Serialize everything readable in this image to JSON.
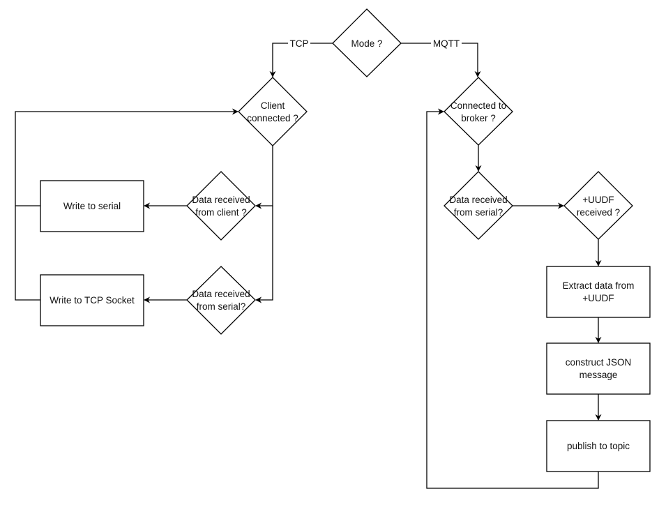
{
  "diagram": {
    "type": "flowchart",
    "nodes": {
      "mode": {
        "shape": "decision",
        "lines": [
          "Mode ?"
        ]
      },
      "client_connected": {
        "shape": "decision",
        "lines": [
          "Client",
          "connected ?"
        ]
      },
      "data_from_client": {
        "shape": "decision",
        "lines": [
          "Data received",
          "from client ?"
        ]
      },
      "write_serial": {
        "shape": "process",
        "lines": [
          "Write to serial"
        ]
      },
      "data_from_serial_tcp": {
        "shape": "decision",
        "lines": [
          "Data received",
          "from serial?"
        ]
      },
      "write_tcp": {
        "shape": "process",
        "lines": [
          "Write to TCP Socket"
        ]
      },
      "connected_broker": {
        "shape": "decision",
        "lines": [
          "Connected to",
          "broker ?"
        ]
      },
      "data_from_serial_mqtt": {
        "shape": "decision",
        "lines": [
          "Data received",
          "from serial?"
        ]
      },
      "uudf_received": {
        "shape": "decision",
        "lines": [
          "+UUDF",
          "received ?"
        ]
      },
      "extract_data": {
        "shape": "process",
        "lines": [
          "Extract data from",
          "+UUDF"
        ]
      },
      "construct_json": {
        "shape": "process",
        "lines": [
          "construct JSON",
          "message"
        ]
      },
      "publish": {
        "shape": "process",
        "lines": [
          "publish to topic"
        ]
      }
    },
    "edges": [
      {
        "from": "mode",
        "to": "client_connected",
        "label": "TCP"
      },
      {
        "from": "mode",
        "to": "connected_broker",
        "label": "MQTT"
      },
      {
        "from": "client_connected",
        "to": "data_from_client",
        "label": ""
      },
      {
        "from": "client_connected",
        "to": "data_from_serial_tcp",
        "label": ""
      },
      {
        "from": "data_from_client",
        "to": "write_serial",
        "label": ""
      },
      {
        "from": "data_from_serial_tcp",
        "to": "write_tcp",
        "label": ""
      },
      {
        "from": "write_serial",
        "to": "client_connected",
        "label": ""
      },
      {
        "from": "write_tcp",
        "to": "client_connected",
        "label": ""
      },
      {
        "from": "connected_broker",
        "to": "data_from_serial_mqtt",
        "label": ""
      },
      {
        "from": "data_from_serial_mqtt",
        "to": "uudf_received",
        "label": ""
      },
      {
        "from": "uudf_received",
        "to": "extract_data",
        "label": ""
      },
      {
        "from": "extract_data",
        "to": "construct_json",
        "label": ""
      },
      {
        "from": "construct_json",
        "to": "publish",
        "label": ""
      },
      {
        "from": "publish",
        "to": "connected_broker",
        "label": ""
      }
    ],
    "edge_labels": {
      "tcp": "TCP",
      "mqtt": "MQTT"
    }
  }
}
